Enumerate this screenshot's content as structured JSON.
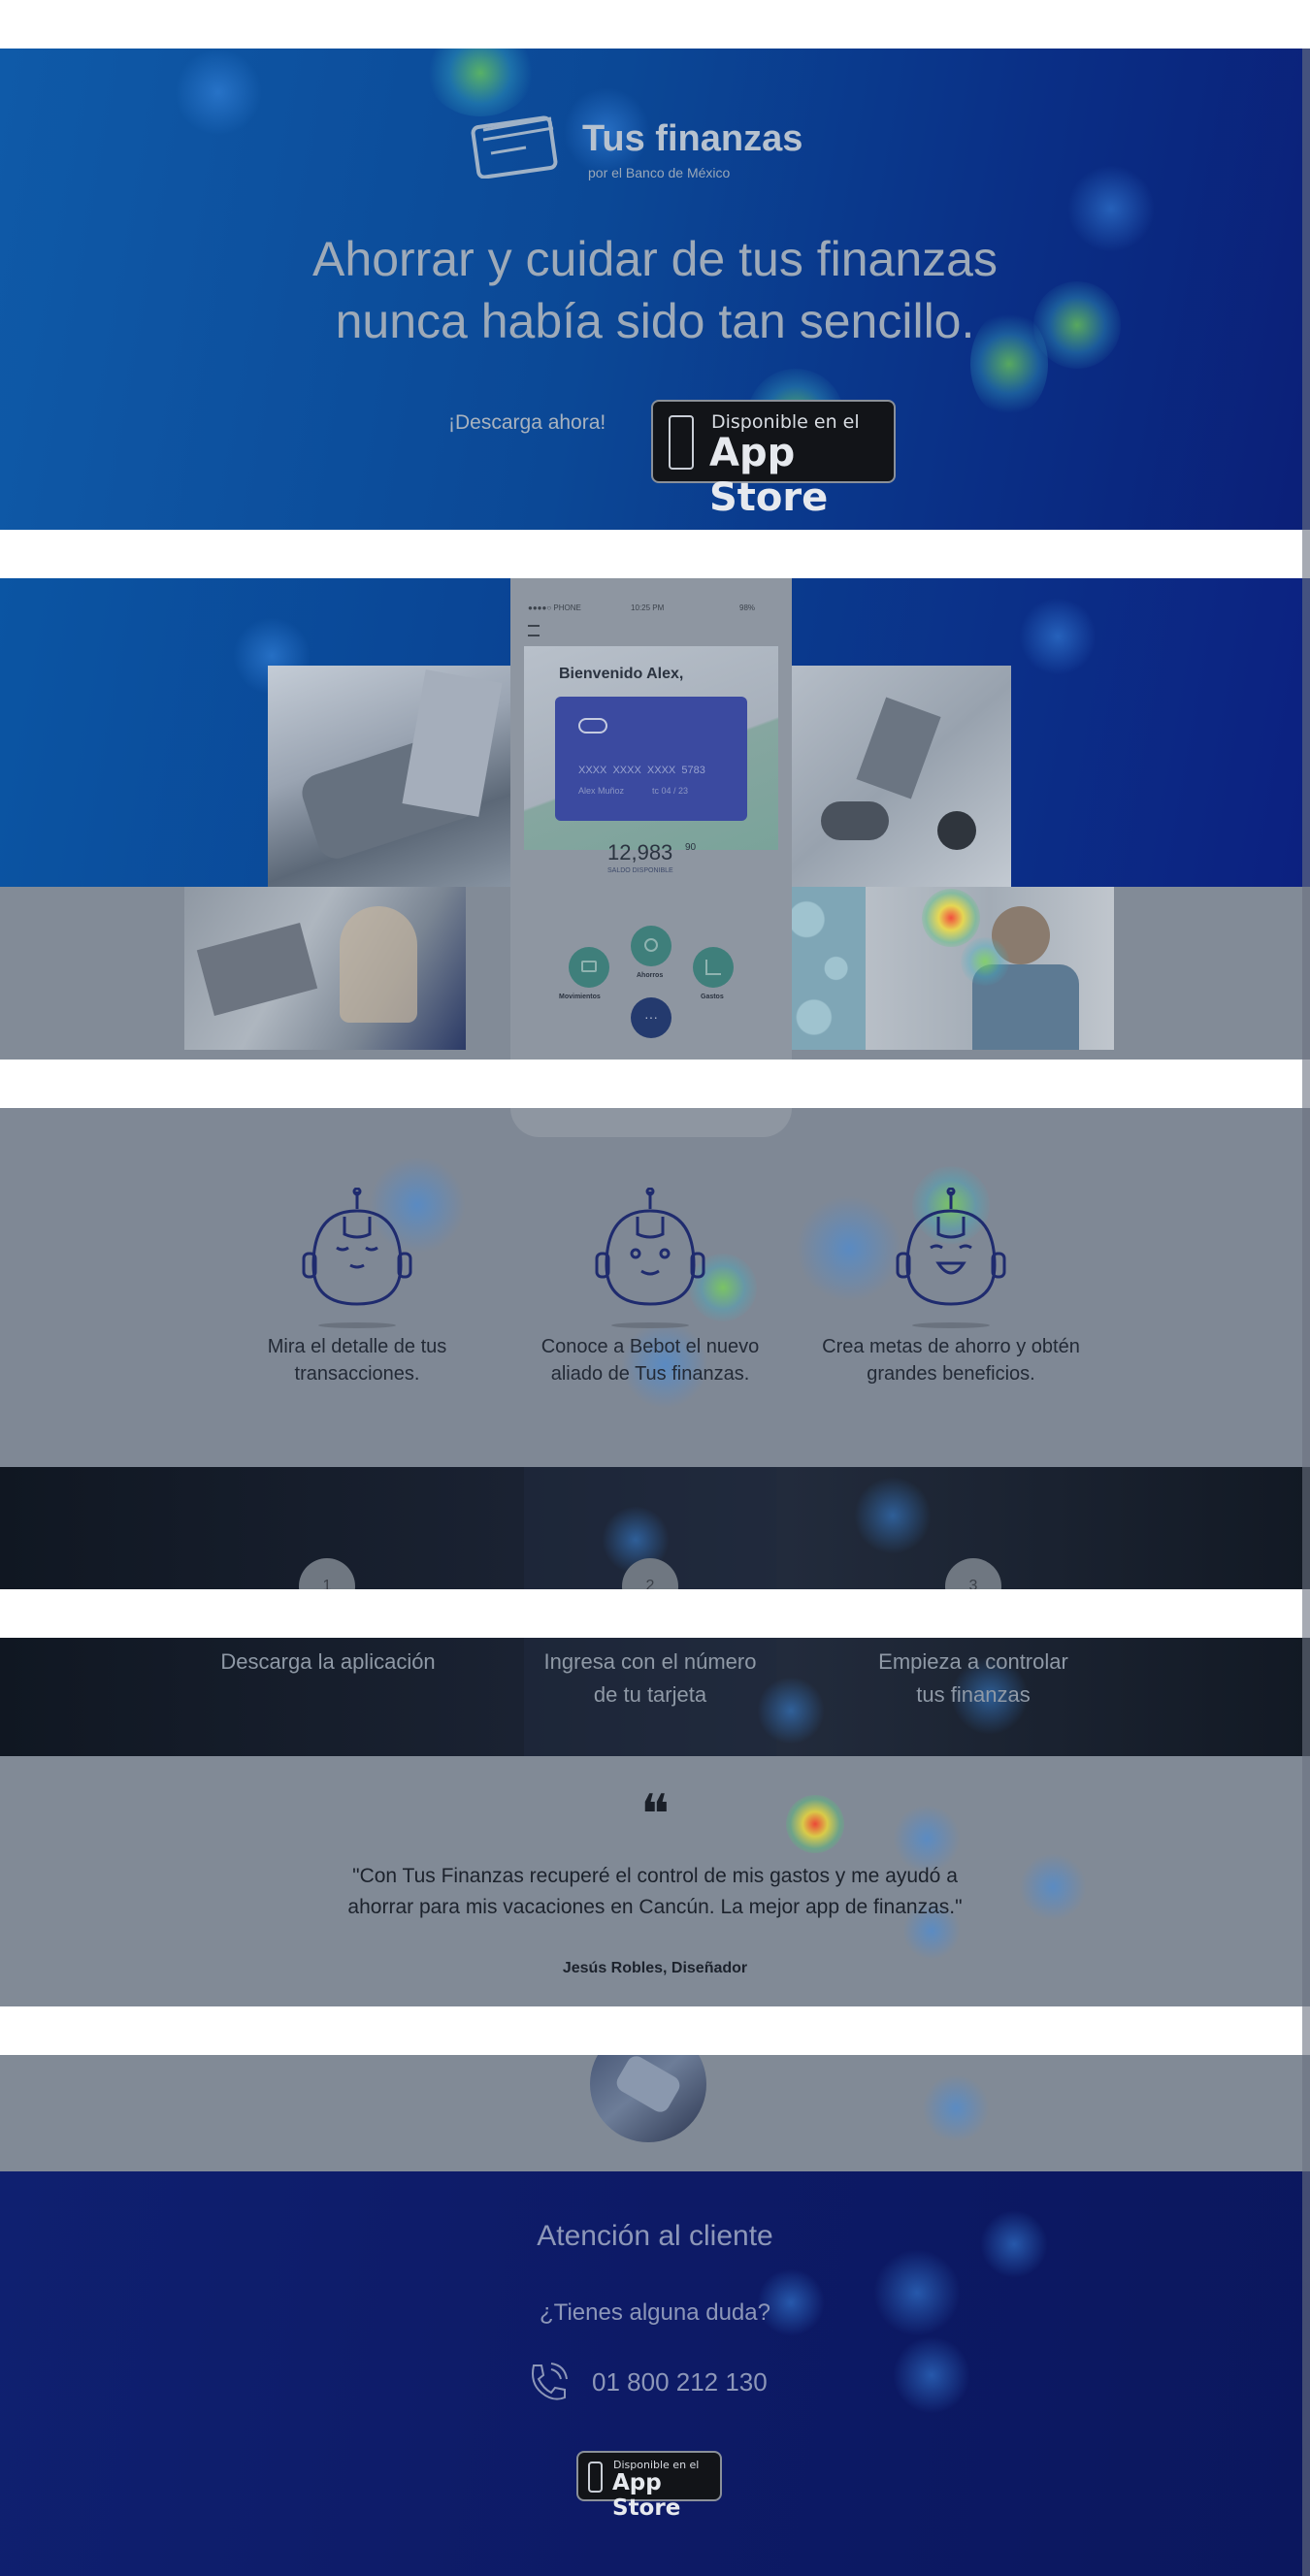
{
  "brand": {
    "name": "Tus finanzas",
    "tagline": "por el Banco de México"
  },
  "hero": {
    "headline_line1": "Ahorrar y cuidar de tus finanzas",
    "headline_line2": "nunca había sido tan sencillo.",
    "download_label": "¡Descarga ahora!"
  },
  "appstore": {
    "small": "Disponible en el",
    "big": "App Store"
  },
  "phone": {
    "status_left": "●●●●○ PHONE",
    "status_time": "10:25 PM",
    "status_right": "98%",
    "welcome": "Bienvenido Alex,",
    "card_number": "XXXX  XXXX  XXXX  5783",
    "card_holder": "Alex Muñoz",
    "card_expiry": "tc 04 / 23",
    "balance_main": "12,983",
    "balance_cents": "90",
    "balance_label": "SALDO DISPONIBLE",
    "actions": [
      "Movimientos",
      "Ahorros",
      "Gastos"
    ],
    "more": "···"
  },
  "features": [
    {
      "line1": "Mira el detalle de tus",
      "line2": "transacciones."
    },
    {
      "line1": "Conoce a Bebot el nuevo",
      "line2": "aliado de Tus finanzas."
    },
    {
      "line1": "Crea metas de ahorro y obtén",
      "line2": "grandes beneficios."
    }
  ],
  "steps": [
    {
      "number": "1",
      "line1": "Descarga la aplicación",
      "line2": ""
    },
    {
      "number": "2",
      "line1": "Ingresa con el número",
      "line2": "de tu tarjeta"
    },
    {
      "number": "3",
      "line1": "Empieza a controlar",
      "line2": "tus finanzas"
    }
  ],
  "testimonial": {
    "quote_mark": "❝",
    "line1": "\"Con Tus Finanzas recuperé el control de mis gastos y me ayudó a",
    "line2": "ahorrar para mis vacaciones en Cancún. La mejor app de finanzas.\"",
    "author": "Jesús Robles, Diseñador"
  },
  "support": {
    "title": "Atención al cliente",
    "question": "¿Tienes alguna duda?",
    "phone": "01 800 212 130"
  },
  "colors": {
    "hero_blue": "#0a4c9a",
    "deep_navy": "#0f1c6a",
    "gray_overlay": "#7e8794",
    "dark_band": "#141b27",
    "robot_stroke": "#1f2b6e"
  },
  "icons": [
    "wallet-cards-icon",
    "apple-phone-icon",
    "robot-bebot-icon",
    "quote-icon",
    "phone-handset-icon",
    "wallet-icon",
    "stopwatch-icon",
    "chart-icon"
  ]
}
